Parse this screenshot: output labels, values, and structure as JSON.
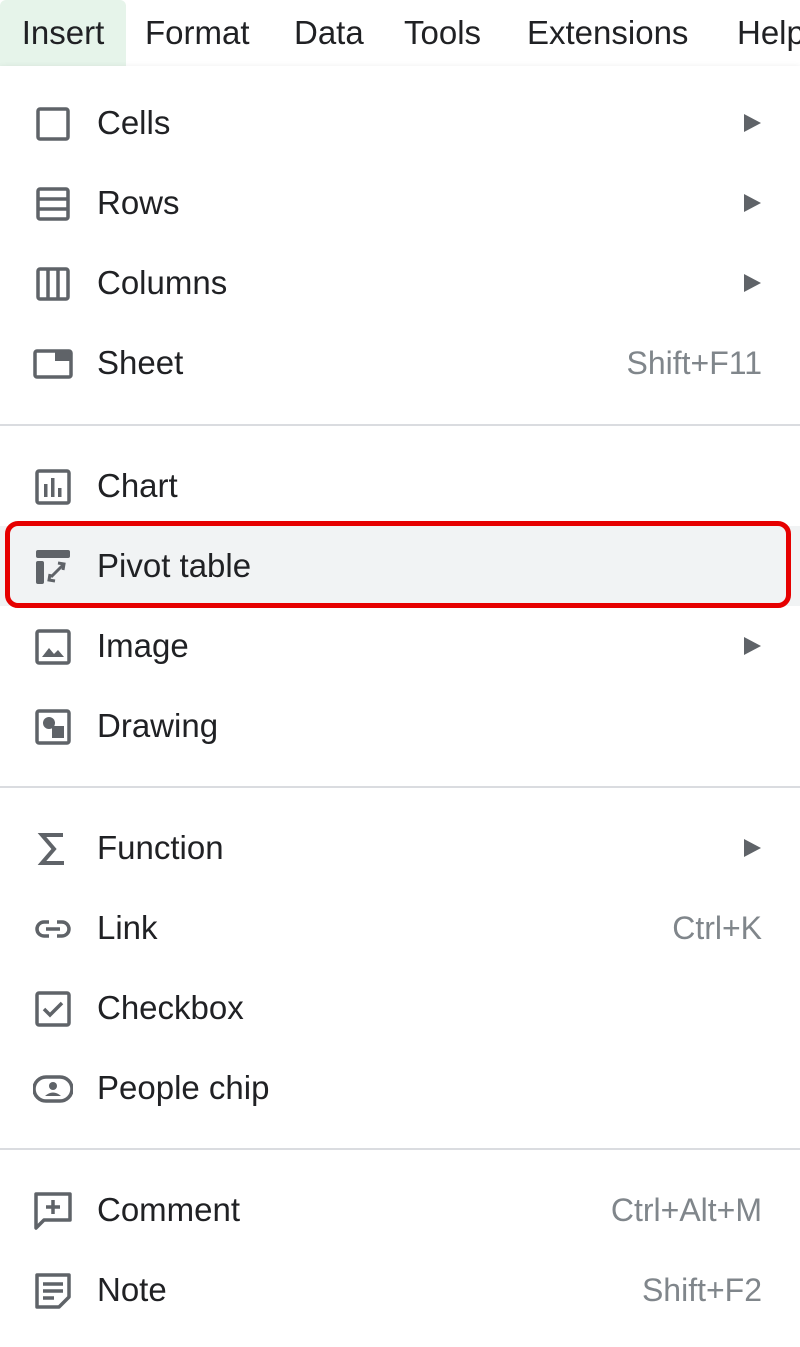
{
  "menubar": {
    "items": [
      {
        "label": "Insert",
        "active": true
      },
      {
        "label": "Format"
      },
      {
        "label": "Data"
      },
      {
        "label": "Tools"
      },
      {
        "label": "Extensions"
      },
      {
        "label": "Help"
      }
    ]
  },
  "insert_menu": {
    "items": [
      {
        "label": "Cells",
        "icon": "cells-icon",
        "submenu": true
      },
      {
        "label": "Rows",
        "icon": "rows-icon",
        "submenu": true
      },
      {
        "label": "Columns",
        "icon": "columns-icon",
        "submenu": true
      },
      {
        "label": "Sheet",
        "icon": "sheet-icon",
        "shortcut": "Shift+F11"
      },
      {
        "label": "Chart",
        "icon": "chart-icon"
      },
      {
        "label": "Pivot table",
        "icon": "pivot-table-icon",
        "highlighted": true
      },
      {
        "label": "Image",
        "icon": "image-icon",
        "submenu": true
      },
      {
        "label": "Drawing",
        "icon": "drawing-icon"
      },
      {
        "label": "Function",
        "icon": "sigma-icon",
        "submenu": true
      },
      {
        "label": "Link",
        "icon": "link-icon",
        "shortcut": "Ctrl+K"
      },
      {
        "label": "Checkbox",
        "icon": "checkbox-icon"
      },
      {
        "label": "People chip",
        "icon": "person-chip-icon"
      },
      {
        "label": "Comment",
        "icon": "comment-icon",
        "shortcut": "Ctrl+Alt+M"
      },
      {
        "label": "Note",
        "icon": "note-icon",
        "shortcut": "Shift+F2"
      }
    ]
  },
  "colors": {
    "highlight_outline": "#e60000",
    "active_menu_bg": "#e6f4ea",
    "hover_bg": "#f1f3f4",
    "shortcut_text": "#80868b"
  }
}
